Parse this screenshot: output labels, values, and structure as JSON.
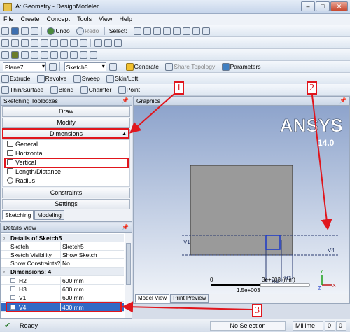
{
  "window": {
    "title": "A: Geometry - DesignModeler",
    "minimize": "–",
    "maximize": "□",
    "close": "✕"
  },
  "menu": [
    "File",
    "Create",
    "Concept",
    "Tools",
    "View",
    "Help"
  ],
  "toolbar1": {
    "undo": "Undo",
    "redo": "Redo",
    "select": "Select:"
  },
  "toolbar3": {
    "plane": "Plane7",
    "sketch": "Sketch5",
    "generate": "Generate",
    "share_topology": "Share Topology",
    "parameters": "Parameters"
  },
  "toolbar4": {
    "extrude": "Extrude",
    "revolve": "Revolve",
    "sweep": "Sweep",
    "skin_loft": "Skin/Loft"
  },
  "toolbar5": {
    "thin_surface": "Thin/Surface",
    "blend": "Blend",
    "chamfer": "Chamfer",
    "point": "Point"
  },
  "toolboxes": {
    "title": "Sketching Toolboxes",
    "draw": "Draw",
    "modify": "Modify",
    "dimensions": "Dimensions",
    "tools": [
      "General",
      "Horizontal",
      "Vertical",
      "Length/Distance",
      "Radius"
    ],
    "constraints": "Constraints",
    "settings": "Settings",
    "tabs": [
      "Sketching",
      "Modeling"
    ]
  },
  "details": {
    "title": "Details View",
    "group1": "Details of Sketch5",
    "rows": [
      {
        "k": "Sketch",
        "v": "Sketch5"
      },
      {
        "k": "Sketch Visibility",
        "v": "Show Sketch"
      },
      {
        "k": "Show Constraints?",
        "v": "No"
      }
    ],
    "group2": "Dimensions: 4",
    "dims": [
      {
        "k": "H2",
        "v": "600 mm"
      },
      {
        "k": "H3",
        "v": "600 mm"
      },
      {
        "k": "V1",
        "v": "600 mm"
      },
      {
        "k": "V4",
        "v": "400 mm"
      }
    ]
  },
  "graphics": {
    "title": "Graphics",
    "logo": "ANSYS",
    "version": "14.0",
    "dim_labels": {
      "v1": "V1",
      "v4": "V4",
      "h2": "H2",
      "h3": "H3"
    },
    "scale": {
      "zero": "0",
      "mid": "3e+003 (mm)",
      "low": "1.5e+003"
    },
    "axis": {
      "x": "X",
      "y": "Y",
      "z": "Z"
    },
    "tabs": [
      "Model View",
      "Print Preview"
    ]
  },
  "status": {
    "ready": "Ready",
    "selection": "No Selection",
    "units": "Millime",
    "x": "0",
    "y": "0"
  },
  "callouts": [
    "1",
    "2",
    "3"
  ],
  "colors": {
    "annotation": "#e0161d",
    "rectangle": "#9a9a9a",
    "selection": "#316ac5"
  }
}
